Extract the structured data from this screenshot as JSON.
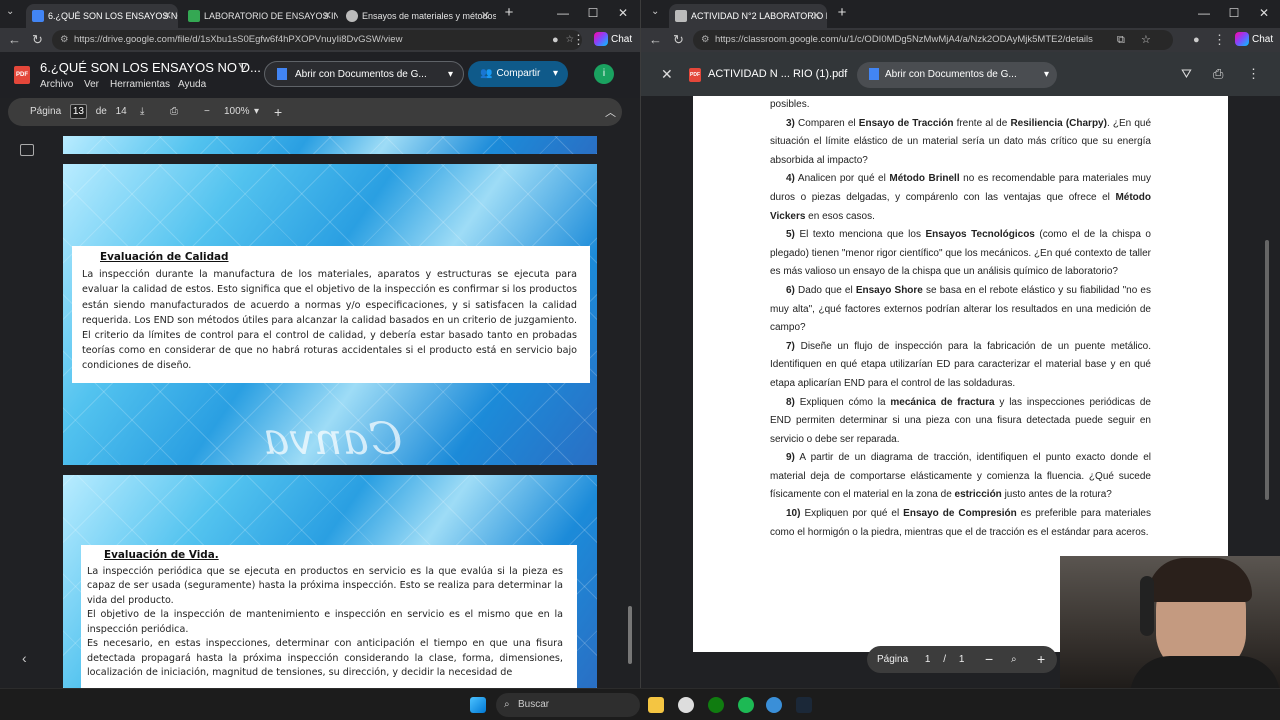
{
  "left": {
    "tabs": [
      {
        "label": "6.¿QUÉ SON LOS ENSAYOS NO D",
        "active": true,
        "color": "#4285f4"
      },
      {
        "label": "LABORATORIO DE ENSAYOS INDU",
        "active": false,
        "color": "#34a853"
      },
      {
        "label": "Ensayos de materiales y métodos",
        "active": false,
        "color": "#bbb"
      }
    ],
    "url": "https://drive.google.com/file/d/1sXbu1sS0Egfw6f4hPXOPVnuyIi8DvGSW/view",
    "chat": "Chat",
    "pdf_badge": "PDF",
    "doc_title": "6.¿QUÉ SON LOS ENSAYOS NO D...",
    "menu": [
      "Archivo",
      "Ver",
      "Herramientas",
      "Ayuda"
    ],
    "open_with": "Abrir con Documentos de G...",
    "share": "Compartir",
    "avatar": "i",
    "page_label": "Página",
    "page_num": "13",
    "page_of": "de",
    "page_total": "14",
    "zoom": "100%",
    "slide1": {
      "title": "Evaluación de Calidad",
      "body": "La inspección durante la manufactura de los materiales, aparatos y estructuras se ejecuta para evaluar la calidad de estos. Esto significa que el objetivo de la inspección es confirmar si los productos están siendo manufacturados de acuerdo a normas y/o especificaciones, y si satisfacen la calidad requerida. Los END son métodos útiles para alcanzar la calidad basados en un criterio de juzgamiento. El criterio da límites de control para el control de calidad, y debería estar basado tanto en probadas teorías como en considerar de que no habrá roturas accidentales si el producto está en servicio bajo condiciones de diseño.",
      "watermark": "Canva"
    },
    "slide2": {
      "title": "Evaluación de Vida.",
      "p1": "La inspección periódica que se ejecuta en productos en servicio es la que evalúa si la pieza es capaz de ser usada (seguramente) hasta la próxima inspección. Esto se realiza para determinar la vida del producto.",
      "p2": "El objetivo de la inspección de mantenimiento e inspección en servicio es el mismo que en la inspección periódica.",
      "p3": "Es necesario, en estas inspecciones, determinar con anticipación el tiempo en que una fisura detectada propagará hasta la próxima inspección considerando la clase, forma, dimensiones, localización de iniciación, magnitud de tensiones, su dirección, y decidir la necesidad de"
    }
  },
  "right": {
    "tab": "ACTIVIDAD N°2 LABORATORIO DE",
    "url": "https://classroom.google.com/u/1/c/ODI0MDg5NzMwMjA4/a/Nzk2ODAyMjk5MTE2/details",
    "chat": "Chat",
    "pdf_badge": "PDF",
    "file": "ACTIVIDAD N ... RIO (1).pdf",
    "open_with": "Abrir con Documentos de G...",
    "page_label": "Página",
    "page_num": "1",
    "page_sep": "/",
    "page_total": "1",
    "items": [
      {
        "pre": "posibles."
      },
      {
        "num": "3)",
        "parts": [
          "Comparen el ",
          "Ensayo de Tracción",
          " frente al de ",
          "Resiliencia (Charpy)",
          ". ¿En qué situación el límite elástico de un material sería un dato más crítico que su energía absorbida al impacto?"
        ]
      },
      {
        "num": "4)",
        "parts": [
          "Analicen por qué el ",
          "Método Brinell",
          " no es recomendable para materiales muy duros o piezas delgadas, y compárenlo con las ventajas que ofrece el ",
          "Método Vickers",
          " en esos casos."
        ]
      },
      {
        "num": "5)",
        "parts": [
          "El texto menciona que los ",
          "Ensayos Tecnológicos",
          " (como el de la chispa o plegado) tienen \"menor rigor científico\" que los mecánicos. ¿En qué contexto de taller es más valioso un ensayo de la chispa que un análisis químico de laboratorio?"
        ]
      },
      {
        "num": "6)",
        "parts": [
          "Dado que el ",
          "Ensayo Shore",
          " se basa en el rebote elástico y su fiabilidad \"no es muy alta\", ¿qué factores externos podrían alterar los resultados en una medición de campo?"
        ]
      },
      {
        "num": "7)",
        "parts": [
          "Diseñe un flujo de inspección para la fabricación de un puente metálico. Identifiquen en qué etapa utilizarían ED para caracterizar el material base y en qué etapa aplicarían END para el control de las soldaduras."
        ]
      },
      {
        "num": "8)",
        "parts": [
          "Expliquen cómo la ",
          "mecánica de fractura",
          " y las inspecciones periódicas de END permiten determinar si una pieza con una fisura detectada puede seguir en servicio o debe ser reparada."
        ]
      },
      {
        "num": "9)",
        "parts": [
          "A partir de un diagrama de tracción, identifiquen el punto exacto donde el material deja de comportarse elásticamente y comienza la fluencia. ¿Qué sucede físicamente con el material en la zona de ",
          "estricción",
          " justo antes de la rotura?"
        ]
      },
      {
        "num": "10)",
        "parts": [
          "Expliquen por qué el ",
          "Ensayo de Compresión",
          " es preferible para materiales como el hormigón o la piedra, mientras que el de tracción es el estándar para aceros."
        ]
      }
    ]
  },
  "taskbar": {
    "search": "Buscar"
  }
}
